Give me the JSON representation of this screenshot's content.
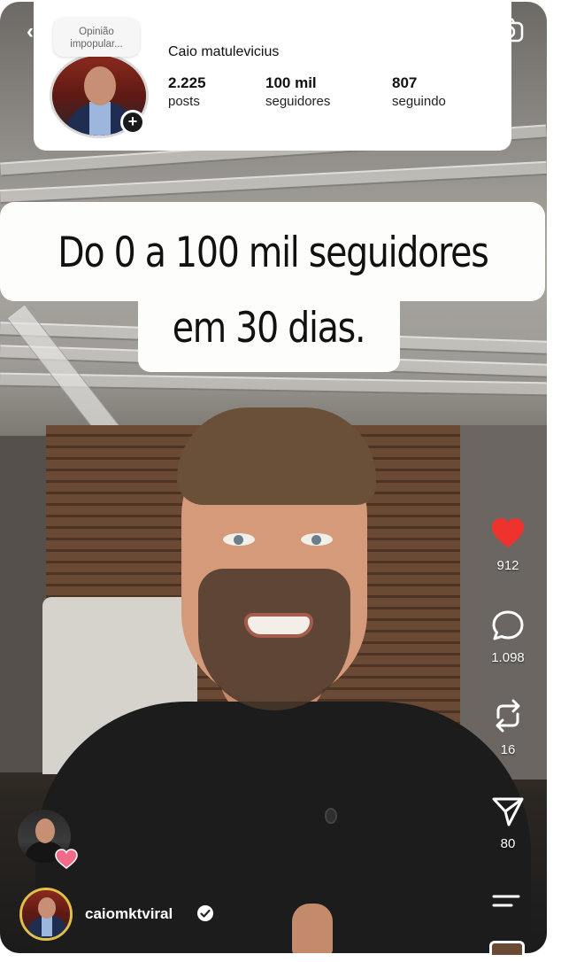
{
  "profile_card": {
    "opinion_bubble": "Opinião\nimpopular...",
    "name": "Caio matulevicius",
    "stats": [
      {
        "value": "2.225",
        "label": "posts"
      },
      {
        "value": "100 mil",
        "label": "seguidores"
      },
      {
        "value": "807",
        "label": "seguindo"
      }
    ],
    "add_badge": "+"
  },
  "caption": {
    "line1": "Do 0 a 100 mil seguidores",
    "line2": "em 30 dias."
  },
  "actions": {
    "likes": "912",
    "comments": "1.098",
    "reposts": "16",
    "shares": "80"
  },
  "author": {
    "username": "caiomktviral"
  },
  "colors": {
    "like_heart": "#f0322f",
    "story_ring": "#e0c04a",
    "caption_bg": "#fdfdfb"
  },
  "icons": [
    "back-arrow-icon",
    "camera-icon",
    "heart-icon",
    "comment-icon",
    "repost-icon",
    "share-icon",
    "menu-icon",
    "verified-icon"
  ]
}
